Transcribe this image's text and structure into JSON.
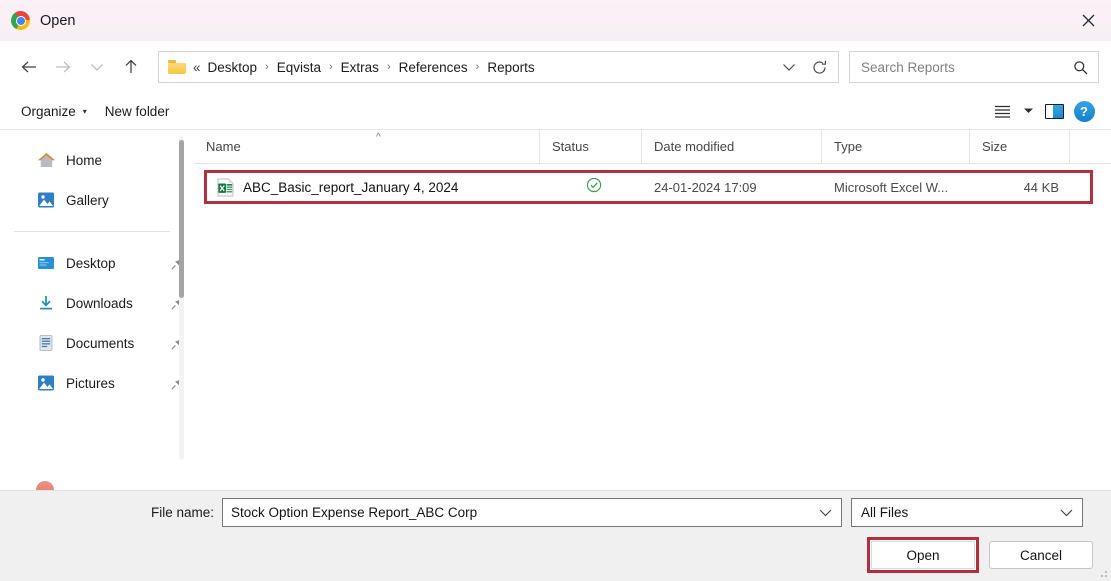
{
  "window": {
    "title": "Open",
    "app_icon": "chrome-icon",
    "close_label": "✕",
    "accent_red": "#b03040",
    "titlebar_bg": "#faf0f5"
  },
  "nav": {
    "back": "←",
    "forward": "→",
    "recent": "⌄",
    "up": "↑"
  },
  "address": {
    "folder_icon": "folder-icon",
    "prefix": "«",
    "crumbs": [
      "Desktop",
      "Eqvista",
      "Extras",
      "References",
      "Reports"
    ],
    "separator": "›",
    "chevron": "⌄",
    "refresh": "⟳"
  },
  "search": {
    "placeholder": "Search Reports",
    "value": "",
    "icon": "search-icon"
  },
  "toolbar": {
    "organize_label": "Organize",
    "organize_caret": "▾",
    "new_folder_label": "New folder",
    "view_icon": "list-view-icon",
    "view_caret": "▾",
    "preview_pane_icon": "preview-pane-icon",
    "help_label": "?"
  },
  "sidebar": {
    "top_items": [
      {
        "label": "Home",
        "icon": "home-icon",
        "pinned": false
      },
      {
        "label": "Gallery",
        "icon": "gallery-icon",
        "pinned": false
      }
    ],
    "quick_access": [
      {
        "label": "Desktop",
        "icon": "desktop-icon",
        "pinned": true
      },
      {
        "label": "Downloads",
        "icon": "downloads-icon",
        "pinned": true
      },
      {
        "label": "Documents",
        "icon": "documents-icon",
        "pinned": true
      },
      {
        "label": "Pictures",
        "icon": "pictures-icon",
        "pinned": true
      }
    ],
    "pin_glyph": "📌"
  },
  "columns": {
    "name": "Name",
    "status": "Status",
    "date_modified": "Date modified",
    "type": "Type",
    "size": "Size",
    "sort_caret": "^"
  },
  "files": [
    {
      "name": "ABC_Basic_report_January 4, 2024",
      "icon": "excel-file-icon",
      "status_icon": "cloud-available-check-icon",
      "date_modified": "24-01-2024 17:09",
      "type": "Microsoft Excel W...",
      "size": "44 KB",
      "highlighted": true
    }
  ],
  "footer": {
    "file_name_label": "File name:",
    "file_name_value": "Stock Option Expense Report_ABC Corp",
    "file_name_caret": "⌄",
    "filter_value": "All Files",
    "filter_caret": "⌄",
    "open_label": "Open",
    "cancel_label": "Cancel"
  }
}
